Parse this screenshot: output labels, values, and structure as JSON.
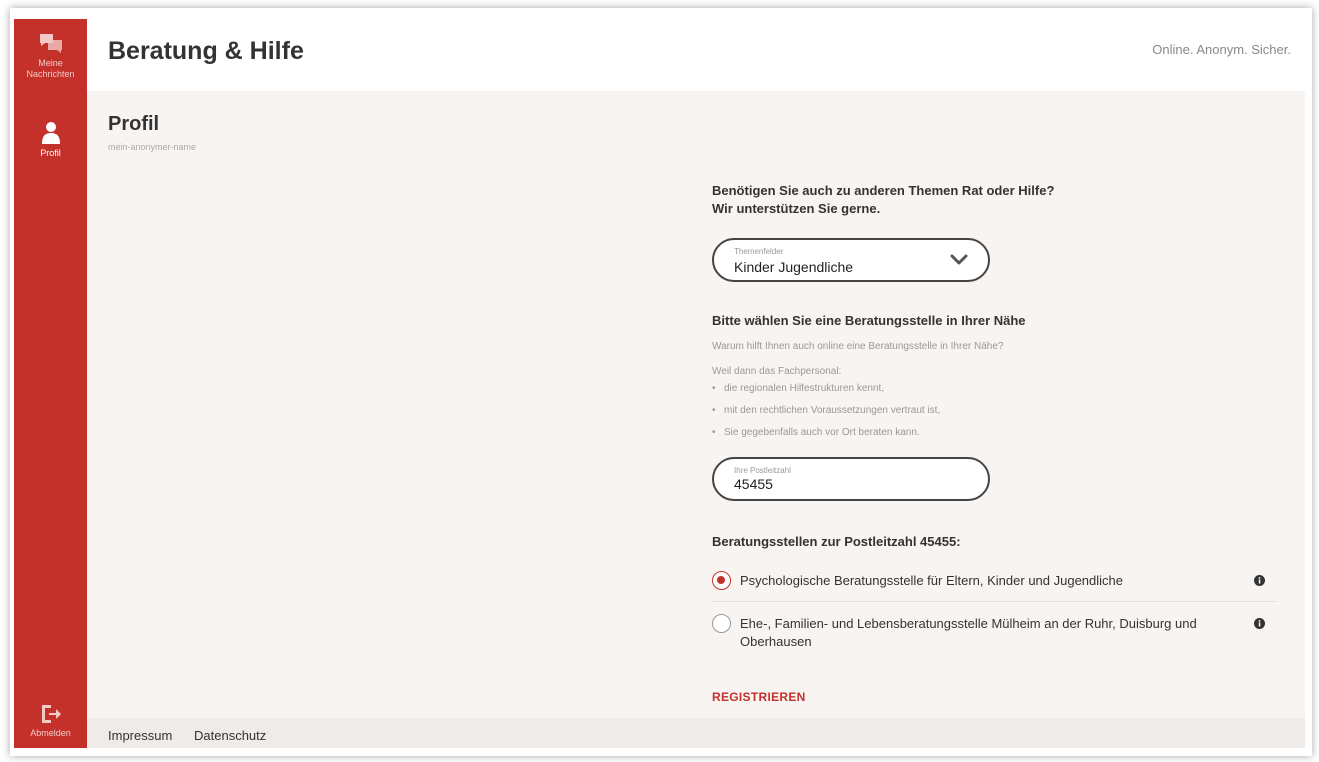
{
  "sidebar": {
    "items": [
      {
        "label_line1": "Meine",
        "label_line2": "Nachrichten",
        "icon": "chat-bubbles-icon"
      },
      {
        "label": "Profil",
        "icon": "person-icon"
      },
      {
        "label": "Abmelden",
        "icon": "logout-icon"
      }
    ]
  },
  "header": {
    "title": "Beratung & Hilfe",
    "tagline": "Online. Anonym. Sicher."
  },
  "profile": {
    "title": "Profil",
    "username": "mein-anonymer-name"
  },
  "panel": {
    "question_line1": "Benötigen Sie auch zu anderen Themen Rat oder Hilfe?",
    "question_line2": "Wir unterstützen Sie gerne.",
    "topic_select": {
      "label": "Themenfelder",
      "value": "Kinder Jugendliche"
    },
    "choose_heading": "Bitte wählen Sie eine Beratungsstelle in Ihrer Nähe",
    "why_text": "Warum hilft Ihnen auch online eine Beratungsstelle in Ihrer Nähe?",
    "because_text": "Weil dann das Fachpersonal:",
    "reasons": [
      "die regionalen Hilfestrukturen kennt,",
      "mit den rechtlichen Voraussetzungen vertraut ist,",
      "Sie gegebenfalls auch vor Ort beraten kann."
    ],
    "zip": {
      "label": "Ihre Postleitzahl",
      "value": "45455"
    },
    "results_heading": "Beratungsstellen zur Postleitzahl 45455:",
    "options": [
      {
        "label": "Psychologische Beratungsstelle für Eltern, Kinder und Jugendliche",
        "selected": true
      },
      {
        "label": "Ehe-, Familien- und Lebensberatungsstelle Mülheim an der Ruhr, Duisburg und Oberhausen",
        "selected": false
      }
    ],
    "register_label": "REGISTRIEREN"
  },
  "footer": {
    "impressum": "Impressum",
    "datenschutz": "Datenschutz"
  },
  "colors": {
    "brand_red": "#c4312b",
    "background": "#f7f4f2"
  }
}
